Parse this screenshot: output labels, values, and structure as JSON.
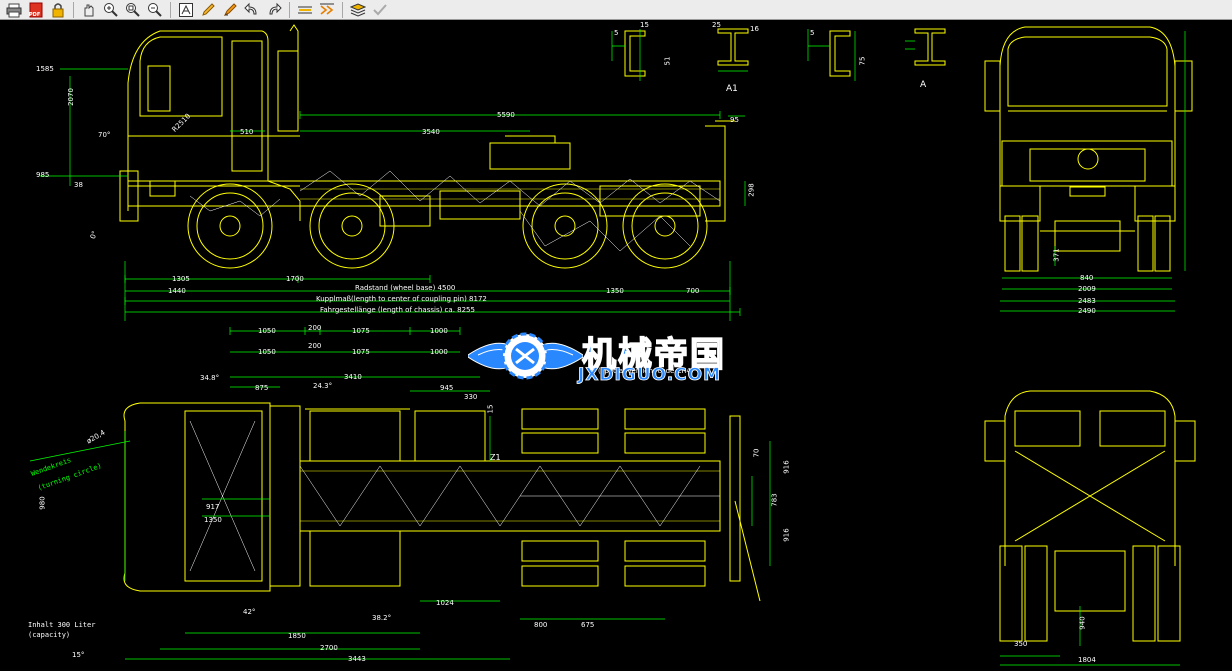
{
  "toolbar": {
    "icons": [
      "print-icon",
      "pdf-icon",
      "lock-icon",
      "pan-hand-icon",
      "zoom-realtime-icon",
      "zoom-window-icon",
      "zoom-extents-icon",
      "text-icon",
      "pencil-icon",
      "highlighter-icon",
      "undo-icon",
      "redo-icon",
      "measure-icon",
      "measure-chain-icon",
      "layers-icon",
      "check-icon"
    ],
    "pdf_label": "PDF"
  },
  "colors": {
    "background": "#000000",
    "drawing_lines": "#ffff00",
    "dimension_lines": "#00ff00",
    "text": "#ffffff",
    "watermark": "#2a88ff"
  },
  "drawing": {
    "side_view": {
      "dims": {
        "d1585": "1585",
        "d2070": "2070",
        "d70": "70°",
        "d510": "510",
        "d3540": "3540",
        "d5590": "5590",
        "d95": "95",
        "d298": "298",
        "d1305": "1305",
        "d1700": "1700",
        "d1440": "1440",
        "d1350": "1350",
        "d700": "700",
        "d985": "985",
        "d38": "38",
        "r2510": "R2510",
        "d0": "0°"
      },
      "wheelbase": "Radstand (wheel base) 4500",
      "coupling": "Kupplmaß(length to center of coupling pin) 8172",
      "chassis": "Fahrgestellänge (length of chassis) ca. 8255"
    },
    "sections": {
      "a1": "A1",
      "a": "A",
      "s5a": "5",
      "s15": "15",
      "s51": "51",
      "s25": "25",
      "s16": "16",
      "s5b": "5",
      "s75": "75"
    },
    "front_view": {
      "d371": "371",
      "d840": "840",
      "d2009": "2009",
      "d2483": "2483",
      "d2490": "2490"
    },
    "top_view": {
      "top_dims": [
        "1050",
        "200",
        "1075",
        "1000"
      ],
      "second_dims": [
        "1050",
        "200",
        "1075",
        "1000"
      ],
      "special": "(special version, code CR4)",
      "d348": "34.8°",
      "d875": "875",
      "d243": "24.3°",
      "d3410": "3410",
      "d945": "945",
      "d330": "330",
      "d15": "15",
      "d70": "70",
      "d916a": "916",
      "d783": "783",
      "d916b": "916",
      "d917": "917",
      "d1350": "1350",
      "d980": "980",
      "d1024": "1024",
      "d382": "38.2°",
      "d42": "42°",
      "d800": "800",
      "d675": "675",
      "d1850": "1850",
      "d2700": "2700",
      "d3443": "3443",
      "d15deg": "15°",
      "z1": "Z1",
      "turning_a": "Wendekreis",
      "turning_b": "(turning circle)",
      "turning_r": "ø20,4",
      "tank_a": "Inhalt    300 Liter",
      "tank_b": "(capacity)"
    },
    "rear_view": {
      "d940": "940",
      "d350": "350",
      "d1804": "1804"
    }
  },
  "watermark": {
    "cn": "机械帝国",
    "en": "JXDIGUO.COM"
  }
}
